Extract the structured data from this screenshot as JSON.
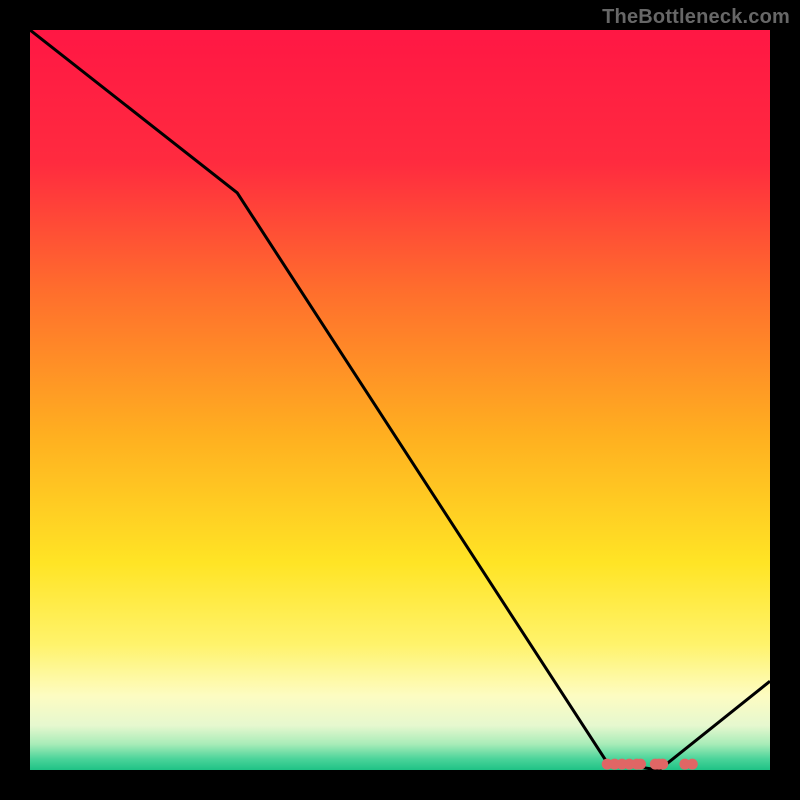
{
  "watermark": "TheBottleneck.com",
  "chart_data": {
    "type": "line",
    "title": "",
    "xlabel": "",
    "ylabel": "",
    "xlim": [
      0,
      100
    ],
    "ylim": [
      0,
      100
    ],
    "grid": false,
    "legend": false,
    "x": [
      0,
      28,
      78,
      85,
      100
    ],
    "values": [
      100,
      78,
      1,
      0,
      12
    ],
    "marker_cluster": {
      "y": 0.8,
      "x": [
        78,
        79,
        80,
        81,
        82,
        82.5,
        84.5,
        85,
        85.5,
        88.5,
        89.5
      ]
    },
    "background_gradient": [
      {
        "offset": 0.0,
        "color": "#ff1744"
      },
      {
        "offset": 0.18,
        "color": "#ff2b3f"
      },
      {
        "offset": 0.35,
        "color": "#ff6d2d"
      },
      {
        "offset": 0.55,
        "color": "#ffb020"
      },
      {
        "offset": 0.72,
        "color": "#ffe425"
      },
      {
        "offset": 0.83,
        "color": "#fff36b"
      },
      {
        "offset": 0.9,
        "color": "#fdfcc2"
      },
      {
        "offset": 0.94,
        "color": "#e6f8cf"
      },
      {
        "offset": 0.965,
        "color": "#a8ecb8"
      },
      {
        "offset": 0.985,
        "color": "#4bd49a"
      },
      {
        "offset": 1.0,
        "color": "#1fc285"
      }
    ],
    "line_color": "#000000",
    "marker_color": "#e06665"
  }
}
